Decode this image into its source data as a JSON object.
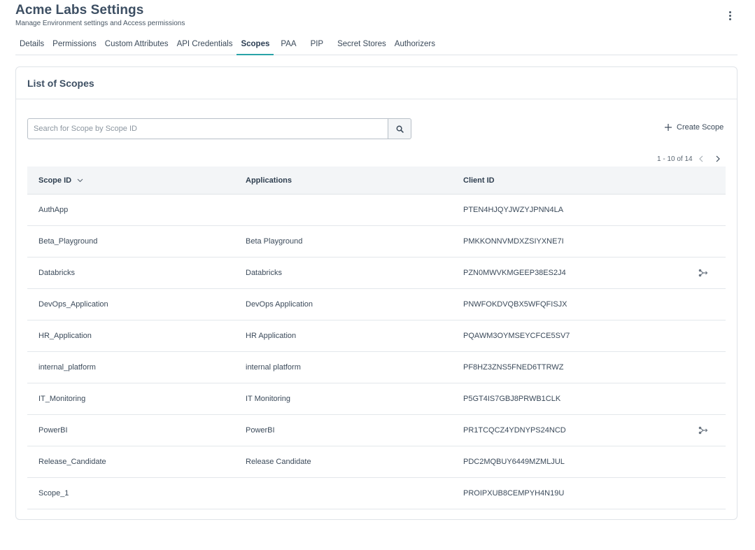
{
  "header": {
    "title": "Acme Labs Settings",
    "subtitle": "Manage Environment settings and Access permissions",
    "more_icon": "kebab-vertical-icon"
  },
  "tabs": [
    {
      "label": "Details",
      "active": false
    },
    {
      "label": "Permissions",
      "active": false
    },
    {
      "label": "Custom Attributes",
      "active": false
    },
    {
      "label": "API Credentials",
      "active": false
    },
    {
      "label": "Scopes",
      "active": true
    },
    {
      "label": "PAA",
      "active": false
    },
    {
      "label": "PIP",
      "active": false
    },
    {
      "label": "Secret Stores",
      "active": false
    },
    {
      "label": "Authorizers",
      "active": false
    }
  ],
  "card": {
    "title": "List of Scopes"
  },
  "search": {
    "placeholder": "Search for Scope by Scope ID",
    "value": "",
    "icon": "search-icon"
  },
  "create": {
    "label": "Create Scope",
    "icon": "plus-icon"
  },
  "pagination": {
    "range": "1 - 10 of 14"
  },
  "table": {
    "columns": [
      "Scope ID",
      "Applications",
      "Client ID"
    ],
    "sort_icon": "chevron-down-icon",
    "rows": [
      {
        "scope_id": "AuthApp",
        "application": "",
        "client_id": "PTEN4HJQYJWZYJPNN4LA",
        "has_action": false
      },
      {
        "scope_id": "Beta_Playground",
        "application": "Beta Playground",
        "client_id": "PMKKONNVMDXZSIYXNE7I",
        "has_action": false
      },
      {
        "scope_id": "Databricks",
        "application": "Databricks",
        "client_id": "PZN0MWVKMGEEP38ES2J4",
        "has_action": true
      },
      {
        "scope_id": "DevOps_Application",
        "application": "DevOps Application",
        "client_id": "PNWFOKDVQBX5WFQFISJX",
        "has_action": false
      },
      {
        "scope_id": "HR_Application",
        "application": "HR Application",
        "client_id": "PQAWM3OYMSEYCFCE5SV7",
        "has_action": false
      },
      {
        "scope_id": "internal_platform",
        "application": "internal platform",
        "client_id": "PF8HZ3ZNS5FNED6TTRWZ",
        "has_action": false
      },
      {
        "scope_id": "IT_Monitoring",
        "application": "IT Monitoring",
        "client_id": "P5GT4IS7GBJ8PRWB1CLK",
        "has_action": false
      },
      {
        "scope_id": "PowerBI",
        "application": "PowerBI",
        "client_id": "PR1TCQCZ4YDNYPS24NCD",
        "has_action": true
      },
      {
        "scope_id": "Release_Candidate",
        "application": "Release Candidate",
        "client_id": "PDC2MQBUY6449MZMLJUL",
        "has_action": false
      },
      {
        "scope_id": "Scope_1",
        "application": "",
        "client_id": "PROIPXUB8CEMPYH4N19U",
        "has_action": false
      }
    ],
    "row_action_icon": "branch-icon"
  },
  "colors": {
    "accent": "#2aa3a8",
    "title": "#3d4f63",
    "header_bg": "#f3f5f7",
    "border": "#dfe3e8"
  }
}
